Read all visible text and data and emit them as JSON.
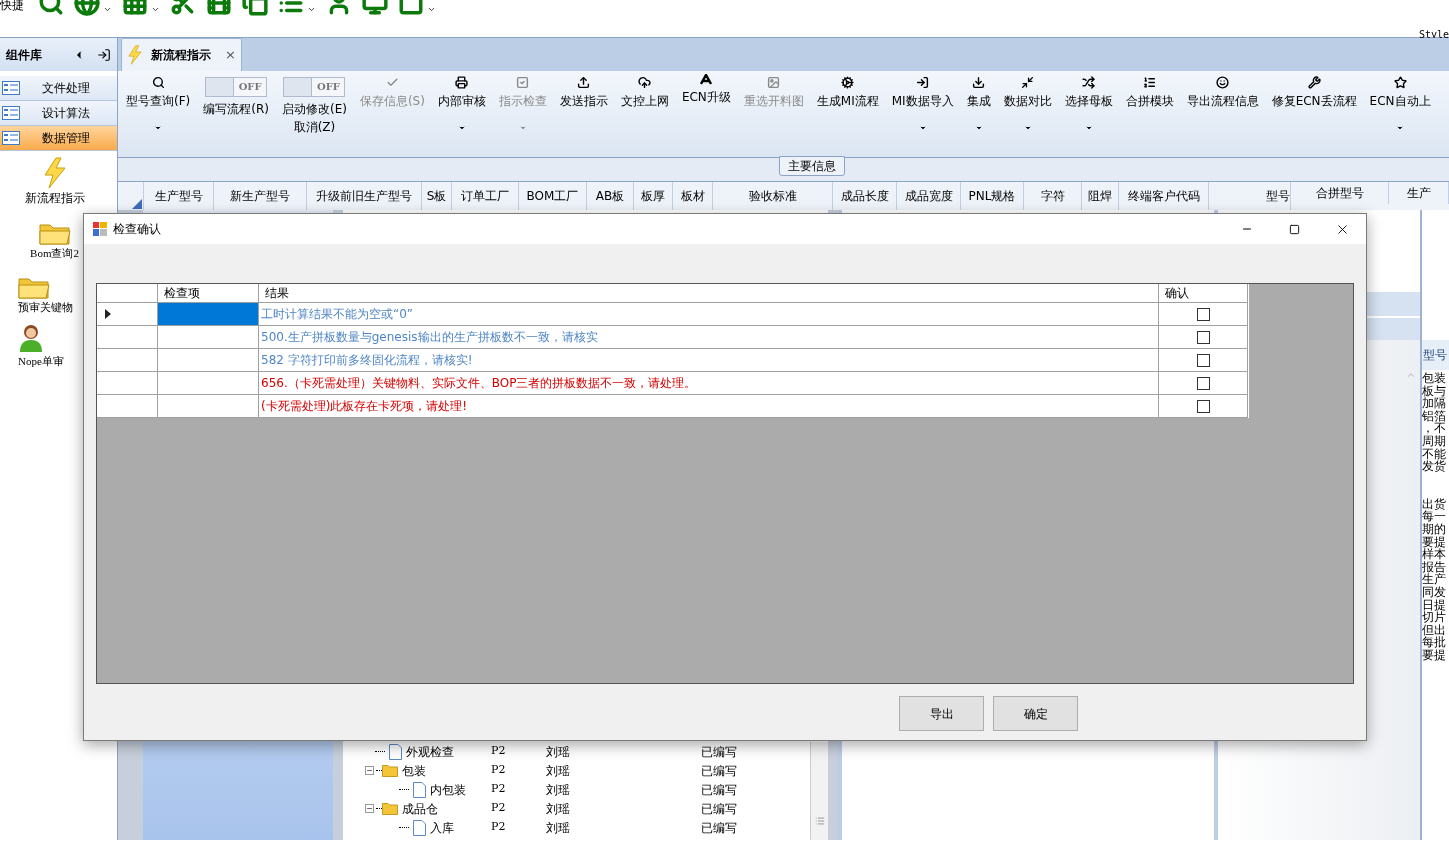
{
  "quick_toolbar": {
    "label": "快捷"
  },
  "style_label": "Style",
  "sidebar": {
    "title": "组件库",
    "categories": [
      {
        "label": "文件处理",
        "selected": false
      },
      {
        "label": "设计算法",
        "selected": false
      },
      {
        "label": "数据管理",
        "selected": true
      }
    ],
    "items": [
      {
        "label": "新流程指示",
        "kind": "bolt"
      },
      {
        "label": "Bom查询2",
        "kind": "folder"
      },
      {
        "label": "预审关键物",
        "kind": "folder"
      },
      {
        "label": "Nope单审",
        "kind": "person"
      }
    ]
  },
  "tab": {
    "label": "新流程指示",
    "close": "×"
  },
  "ribbon": [
    {
      "kind": "button",
      "label": "型号查询(F)",
      "disabled": false,
      "dropdown": true
    },
    {
      "kind": "toggle",
      "label": "编写流程(R)",
      "toggle_text": "OFF",
      "on": false
    },
    {
      "kind": "toggle",
      "label": "启动修改(E)",
      "label2": "取消(Z)",
      "toggle_text": "OFF",
      "on": false
    },
    {
      "kind": "button",
      "label": "保存信息(S)",
      "disabled": true,
      "dropdown": false
    },
    {
      "kind": "button",
      "label": "内部审核",
      "disabled": false,
      "dropdown": true
    },
    {
      "kind": "button",
      "label": "指示检查",
      "disabled": true,
      "dropdown": true
    },
    {
      "kind": "button",
      "label": "发送指示",
      "disabled": false,
      "dropdown": false
    },
    {
      "kind": "button",
      "label": "文控上网",
      "disabled": false,
      "dropdown": false
    },
    {
      "kind": "button",
      "label": "ECN升级",
      "disabled": false,
      "dropdown": false
    },
    {
      "kind": "button",
      "label": "重选开料图",
      "disabled": true,
      "dropdown": false
    },
    {
      "kind": "button",
      "label": "生成MI流程",
      "disabled": false,
      "dropdown": false
    },
    {
      "kind": "button",
      "label": "MI数据导入",
      "disabled": false,
      "dropdown": true
    },
    {
      "kind": "button",
      "label": "集成",
      "disabled": false,
      "dropdown": true
    },
    {
      "kind": "button",
      "label": "数据对比",
      "disabled": false,
      "dropdown": true
    },
    {
      "kind": "button",
      "label": "选择母板",
      "disabled": false,
      "dropdown": true
    },
    {
      "kind": "button",
      "label": "合拼模块",
      "disabled": false,
      "dropdown": false
    },
    {
      "kind": "button",
      "label": "导出流程信息",
      "disabled": false,
      "dropdown": false
    },
    {
      "kind": "button",
      "label": "修复ECN丢流程",
      "disabled": false,
      "dropdown": false
    },
    {
      "kind": "button",
      "label": "ECN自动上",
      "disabled": false,
      "dropdown": true
    }
  ],
  "group_title": "主要信息",
  "columns": [
    "生产型号",
    "新生产型号",
    "升级前旧生产型号",
    "S板",
    "订单工厂",
    "BOM工厂",
    "AB板",
    "板厚",
    "板材",
    "验收标准",
    "成品长度",
    "成品宽度",
    "PNL规格",
    "字符",
    "阻焊",
    "终端客户代码",
    "型号"
  ],
  "columns_right": [
    "合拼型号",
    "生产"
  ],
  "dialog": {
    "title": "检查确认",
    "columns": [
      "检查项",
      "结果",
      "确认"
    ],
    "rows": [
      {
        "result": "工时计算结果不能为空或“0”",
        "color": "#4f86c6",
        "checked": false,
        "selected": true
      },
      {
        "result": "500.生产拼板数量与genesis输出的生产拼板数不一致，请核实",
        "color": "#4f86c6",
        "checked": false,
        "selected": false
      },
      {
        "result": "582 字符打印前多终固化流程，请核实!",
        "color": "#4f86c6",
        "checked": false,
        "selected": false
      },
      {
        "result": "656.（卡死需处理）关键物料、实际文件、BOP三者的拼板数据不一致，请处理。",
        "color": "#d40000",
        "checked": false,
        "selected": false
      },
      {
        "result": "(卡死需处理)此板存在卡死项，请处理!",
        "color": "#d40000",
        "checked": false,
        "selected": false
      }
    ],
    "buttons": [
      "导出",
      "确定"
    ]
  },
  "tree": [
    {
      "label": "外观检查",
      "kind": "file",
      "code": "P2",
      "person": "刘瑶",
      "status": "已编写"
    },
    {
      "label": "包装",
      "kind": "folder",
      "expanded": true,
      "code": "P2",
      "person": "刘瑶",
      "status": "已编写",
      "children": [
        {
          "label": "内包装",
          "kind": "file",
          "code": "P2",
          "person": "刘瑶",
          "status": "已编写"
        }
      ]
    },
    {
      "label": "成品仓",
      "kind": "folder",
      "expanded": true,
      "code": "P2",
      "person": "刘瑶",
      "status": "已编写",
      "children": [
        {
          "label": "入库",
          "kind": "file",
          "code": "P2",
          "person": "刘瑶",
          "status": "已编写"
        }
      ]
    }
  ],
  "right_column": {
    "header": "型号",
    "paragraphs": [
      [
        "包装",
        "板与",
        "加隔",
        "铝箔",
        "，不",
        "周期",
        "不能",
        "发货"
      ],
      [
        "出货",
        "每一",
        "期的",
        "要提",
        "样本",
        "报告",
        "生产",
        "同发",
        "日提",
        "切片",
        "但出",
        "每批",
        "要提"
      ]
    ]
  }
}
